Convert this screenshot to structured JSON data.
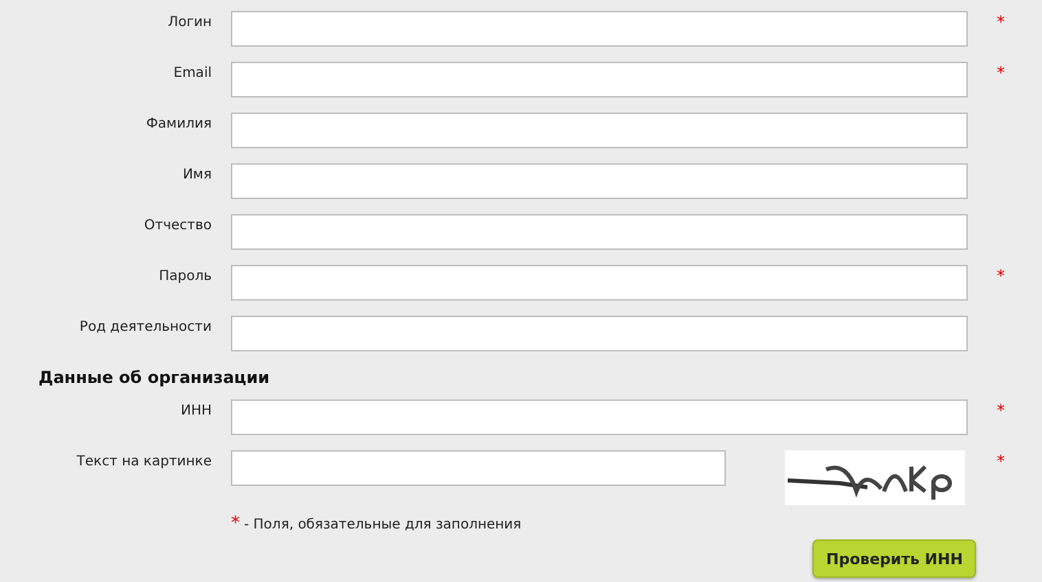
{
  "fields": [
    {
      "label": "Логин",
      "mark": "*"
    },
    {
      "label": "Email",
      "mark": "*"
    },
    {
      "label": "Фамилия"
    },
    {
      "label": "Имя"
    },
    {
      "label": "Отчество"
    },
    {
      "label": "Пароль",
      "mark": "*"
    },
    {
      "label": "Род деятельности"
    }
  ],
  "section_title": "Данные об организации",
  "org_fields": [
    {
      "kind": "text",
      "label": "ИНН",
      "mark": "*"
    },
    {
      "kind": "captcha",
      "label": "Текст на картинке",
      "mark": "*"
    }
  ],
  "note": {
    "mark": "*",
    "text": "- Поля, обязательные для заполнения"
  },
  "button": "Проверить ИНН"
}
